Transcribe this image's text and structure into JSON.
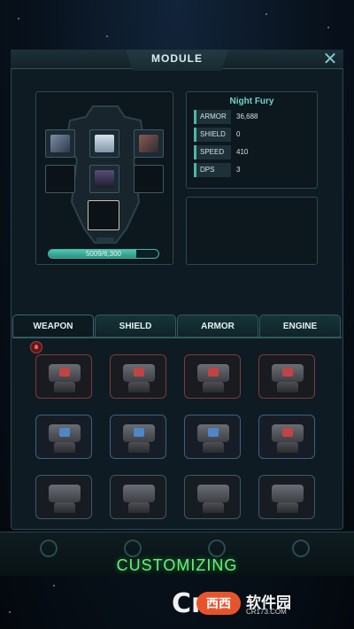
{
  "header": {
    "title": "MODULE",
    "close_icon": "close-icon"
  },
  "ship": {
    "name": "Night Fury",
    "progress_text": "5009/6,300",
    "progress_value": 5009,
    "progress_max": 6300
  },
  "stats": [
    {
      "label": "ARMOR",
      "value": "36,688"
    },
    {
      "label": "SHIELD",
      "value": "0"
    },
    {
      "label": "SPEED",
      "value": "410"
    },
    {
      "label": "DPS",
      "value": "3"
    }
  ],
  "tabs": [
    {
      "label": "WEAPON",
      "active": true
    },
    {
      "label": "SHIELD",
      "active": false
    },
    {
      "label": "ARMOR",
      "active": false
    },
    {
      "label": "ENGINE",
      "active": false
    }
  ],
  "modules": {
    "row1_color": "#7a3a3a",
    "row2_color": "#3d5f85",
    "row3_color": "#3f5860",
    "accent_red": "#d04848",
    "accent_blue": "#4f86c8"
  },
  "caption": "CUSTOMIZING",
  "watermark": {
    "mark": "Cr",
    "badge": "西西",
    "name": "软件园",
    "url": "CR173.COM"
  }
}
